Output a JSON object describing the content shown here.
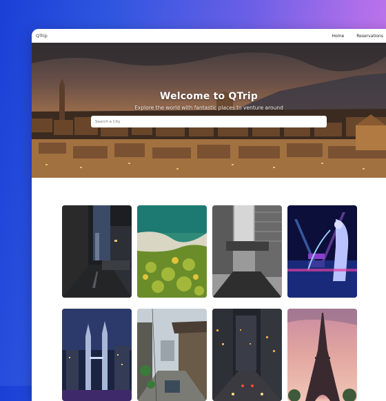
{
  "navbar": {
    "brand": "QTrip",
    "links": [
      {
        "label": "Home"
      },
      {
        "label": "Reservations"
      }
    ]
  },
  "hero": {
    "title": "Welcome to QTrip",
    "subtitle": "Explore the world with fantastic places to venture around",
    "search_placeholder": "Search a City"
  },
  "cities": [
    {
      "scene": "rainy-night-alley"
    },
    {
      "scene": "aerial-beach-forest"
    },
    {
      "scene": "bw-skyscraper-bridge"
    },
    {
      "scene": "merlion-marina-bay"
    },
    {
      "scene": "petronas-towers-night"
    },
    {
      "scene": "asian-street-market"
    },
    {
      "scene": "city-street-night-traffic"
    },
    {
      "scene": "eiffel-tower-sunset"
    }
  ]
}
